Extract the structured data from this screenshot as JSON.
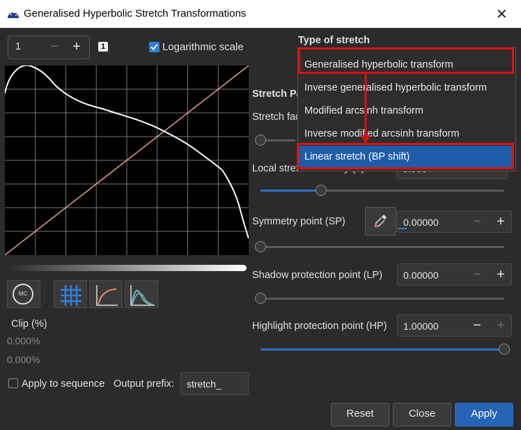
{
  "window": {
    "title": "Generalised Hyperbolic Stretch Transformations"
  },
  "history": {
    "value": "1",
    "badge": "1"
  },
  "log_scale": {
    "label": "Logarithmic scale",
    "checked": true
  },
  "stretch_type": {
    "label": "Type of stretch",
    "options": [
      "Generalised hyperbolic transform",
      "Inverse generalised hyperbolic transform",
      "Modified arcsinh transform",
      "Inverse modified arcsinh transform",
      "Linear stretch (BP shift)"
    ],
    "selected_index": 4
  },
  "params": {
    "section_title": "Stretch Pa",
    "stretch_factor_label": "Stretch fac",
    "local_intensity_label": "Local stretch intensity (b)",
    "local_intensity_value": "0.000",
    "symmetry_label": "Symmetry point (SP)",
    "symmetry_value": "0.00000",
    "shadow_label": "Shadow protection point (LP)",
    "shadow_value": "0.00000",
    "highlight_label": "Highlight protection point (HP)",
    "highlight_value": "1.00000"
  },
  "sliders": {
    "stretch_factor": 0.0,
    "local_intensity": 0.25,
    "symmetry": 0.0,
    "shadow": 0.0,
    "highlight": 1.0
  },
  "tools": {
    "mc_label": "MC"
  },
  "clip": {
    "label": "Clip (%)",
    "low": "0.000%",
    "high": "0.000%"
  },
  "sequence": {
    "label": "Apply to sequence",
    "checked": false,
    "prefix_label": "Output prefix:",
    "prefix_value": "stretch_"
  },
  "buttons": {
    "reset": "Reset",
    "close": "Close",
    "apply": "Apply"
  },
  "colors": {
    "accent": "#2563b4",
    "highlight_box": "#e01010",
    "selected_item": "#1e5ba8"
  }
}
